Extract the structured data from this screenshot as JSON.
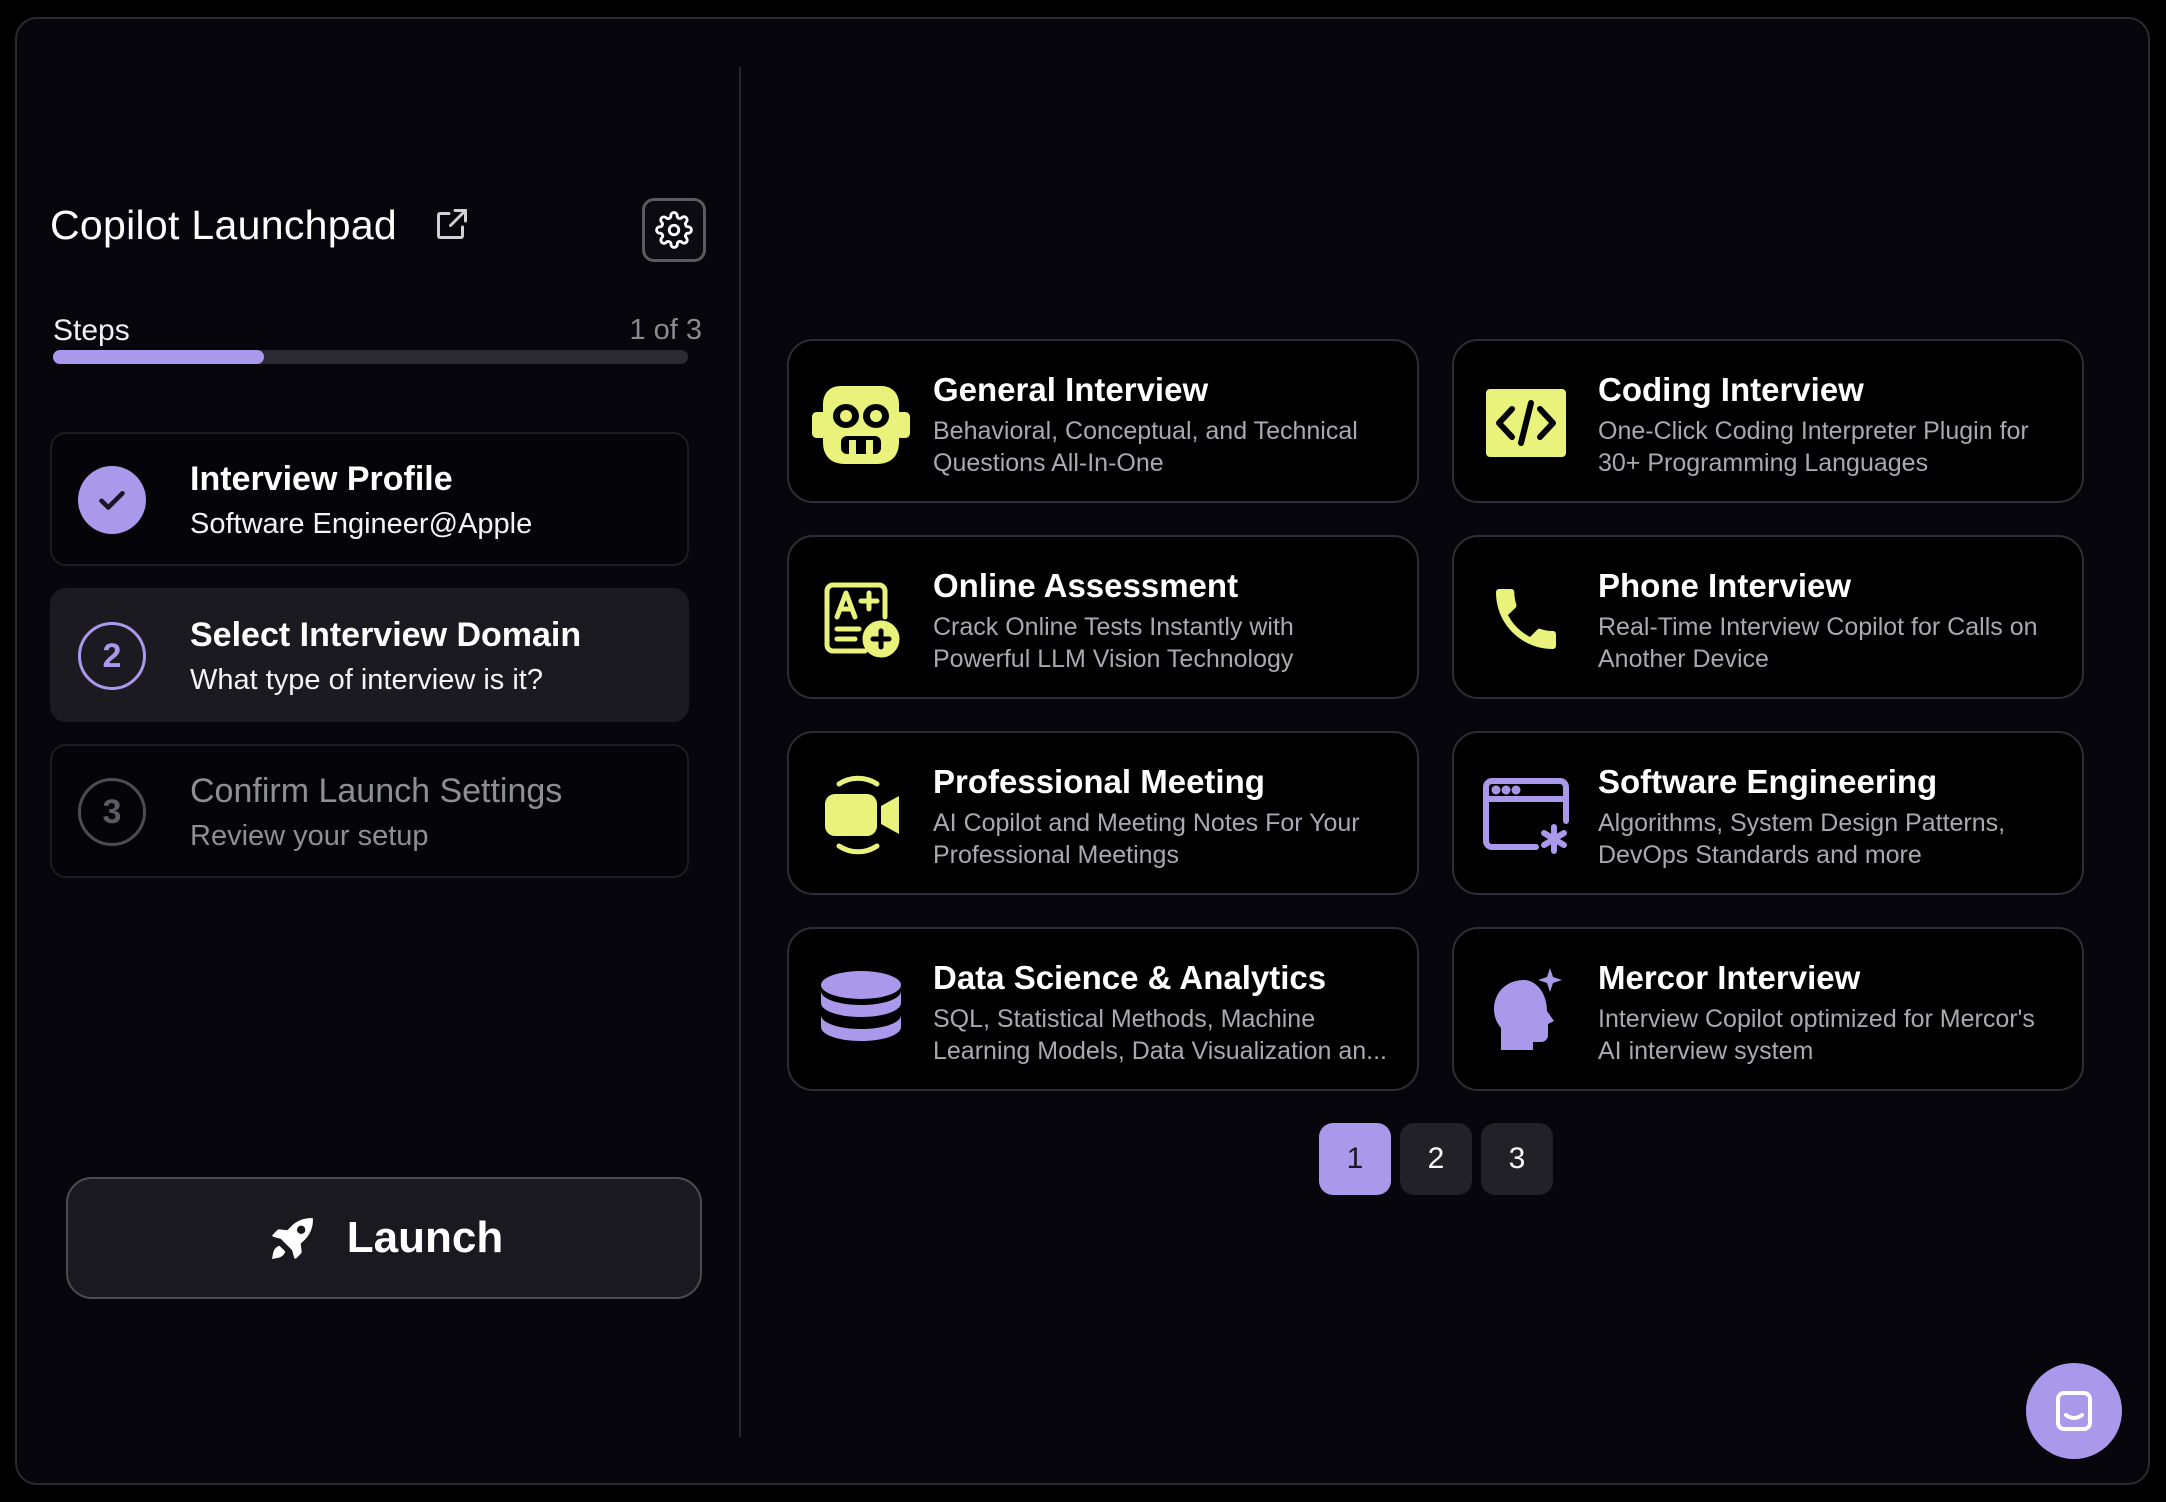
{
  "header": {
    "title": "Copilot Launchpad",
    "external_icon": "external-link-icon",
    "settings_icon": "gear-icon"
  },
  "steps": {
    "label": "Steps",
    "count": "1 of 3",
    "progress_fraction": 0.333,
    "items": [
      {
        "number": "1",
        "title": "Interview Profile",
        "subtitle": "Software Engineer@Apple",
        "state": "done"
      },
      {
        "number": "2",
        "title": "Select Interview Domain",
        "subtitle": "What type of interview is it?",
        "state": "current"
      },
      {
        "number": "3",
        "title": "Confirm Launch Settings",
        "subtitle": "Review your setup",
        "state": "todo"
      }
    ]
  },
  "launch": {
    "label": "Launch",
    "icon": "rocket-icon"
  },
  "cards": [
    {
      "title": "General Interview",
      "desc": [
        "Behavioral, Conceptual, and Technical",
        "Questions All-In-One"
      ],
      "icon": "robot-icon"
    },
    {
      "title": "Coding Interview",
      "desc": [
        "One-Click Coding Interpreter Plugin for",
        "30+ Programming Languages"
      ],
      "icon": "code-icon"
    },
    {
      "title": "Online Assessment",
      "desc": [
        "Crack Online Tests Instantly with",
        "Powerful LLM Vision Technology"
      ],
      "icon": "grade-icon"
    },
    {
      "title": "Phone Interview",
      "desc": [
        "Real-Time Interview Copilot for Calls on",
        "Another Device"
      ],
      "icon": "phone-icon"
    },
    {
      "title": "Professional Meeting",
      "desc": [
        "AI Copilot and Meeting Notes For Your",
        "Professional Meetings"
      ],
      "icon": "video-call-icon"
    },
    {
      "title": "Software Engineering",
      "desc": [
        "Algorithms, System Design Patterns,",
        "DevOps Standards and more"
      ],
      "icon": "browser-settings-icon"
    },
    {
      "title": "Data Science & Analytics",
      "desc": [
        "SQL, Statistical Methods, Machine",
        "Learning Models, Data Visualization an..."
      ],
      "icon": "database-icon"
    },
    {
      "title": "Mercor Interview",
      "desc": [
        "Interview Copilot optimized for Mercor's",
        "AI interview system"
      ],
      "icon": "ai-head-icon"
    }
  ],
  "pagination": {
    "pages": [
      "1",
      "2",
      "3"
    ],
    "current": "1"
  },
  "chat": {
    "icon": "chat-icon"
  },
  "colors": {
    "accent": "#aa98ea",
    "icon_yellow": "#e9f27a",
    "background": "#07060c"
  }
}
